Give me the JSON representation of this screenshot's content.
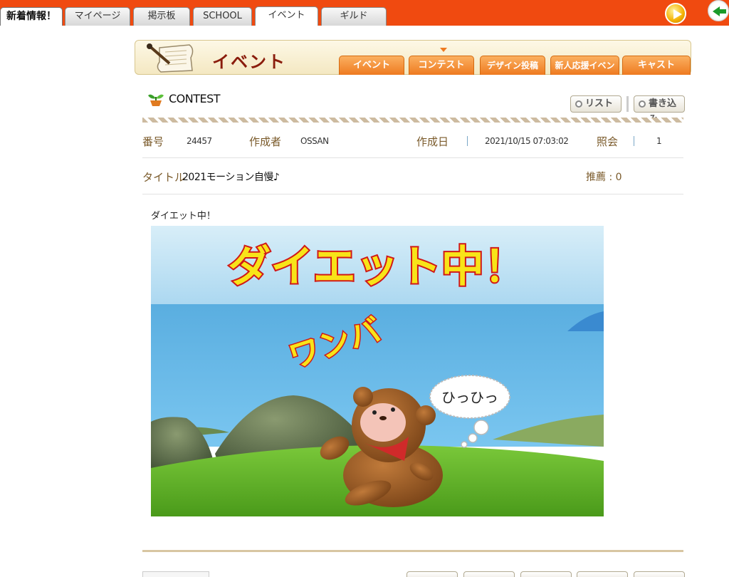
{
  "top_tabs": [
    {
      "label": "新着情報！"
    },
    {
      "label": "マイページ"
    },
    {
      "label": "掲示板"
    },
    {
      "label": "SCHOOL"
    },
    {
      "label": "イベント"
    },
    {
      "label": "ギルド"
    }
  ],
  "banner": {
    "title": "イベント",
    "tabs": [
      "イベント",
      "コンテスト",
      "デザイン投稿",
      "新人応援イベント",
      "キャスト"
    ]
  },
  "section": {
    "title": "CONTEST",
    "list_button": "リスト",
    "write_button": "書き込み"
  },
  "meta": {
    "number_label": "番号",
    "number_value": "24457",
    "author_label": "作成者",
    "author_value": "OSSAN",
    "date_label": "作成日",
    "date_value": "2021/10/15 07:03:02",
    "views_label": "照会",
    "views_value": "1"
  },
  "post": {
    "title_label": "タイトル",
    "title_value": "2021モーション自慢♪",
    "recommend": "推薦 : 0",
    "body_text": "ダイエット中！"
  },
  "image": {
    "caption_big": "ダイエット中！",
    "caption_sound": "ワンバ",
    "bubble_text": "ひっひっ"
  },
  "colors": {
    "topbar": "#f04a10",
    "banner_title": "#8a1c0c",
    "subtab": "#ee7a20",
    "label": "#7a5a2a"
  }
}
